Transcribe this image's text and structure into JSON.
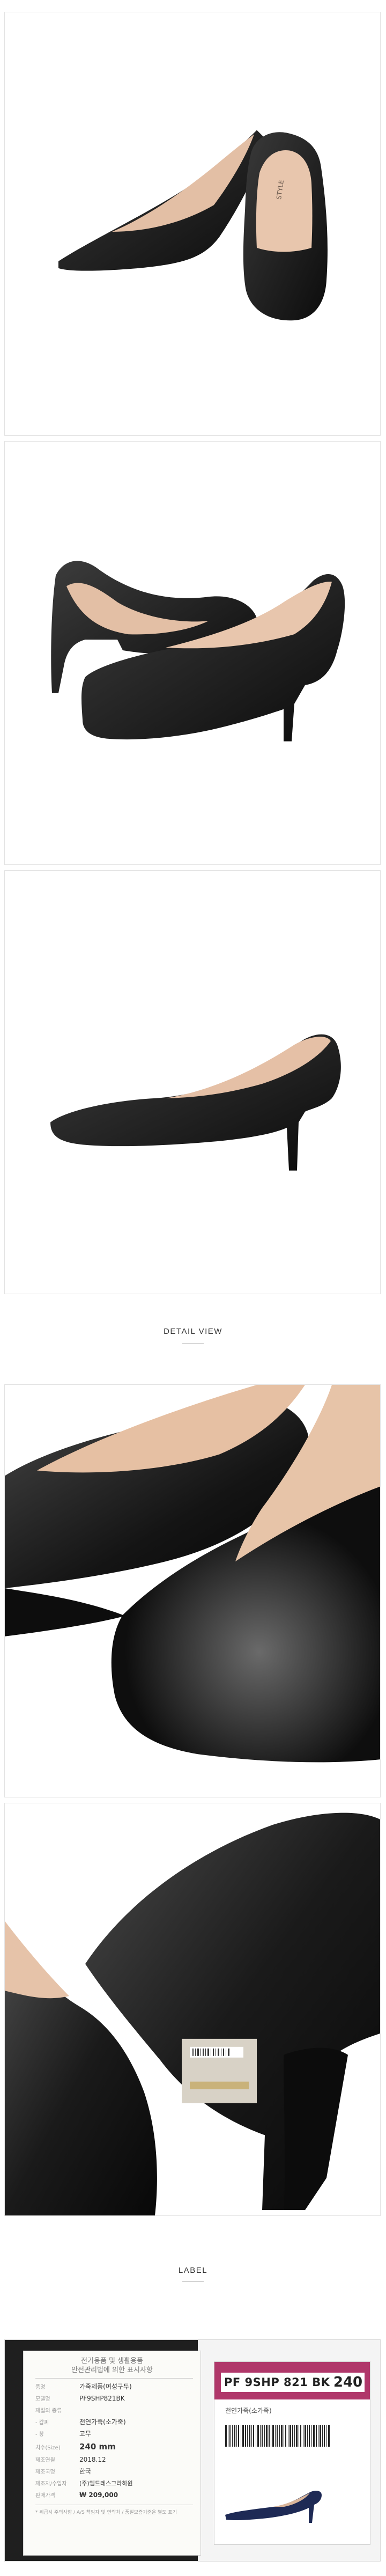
{
  "sections": {
    "detail_heading": "DETAIL VIEW",
    "label_heading": "LABEL"
  },
  "label_card": {
    "title_line1": "전기용품 및 생활용품",
    "title_line2": "안전관리법에 의한 표시사항",
    "rows": [
      {
        "key": "품명",
        "value": "가죽제품(여성구두)"
      },
      {
        "key": "모델명",
        "value": "PF9SHP821BK"
      },
      {
        "key": "재질의 종류",
        "value": ""
      },
      {
        "key": "- 갑피",
        "value": "천연가죽(소가죽)"
      },
      {
        "key": "- 창",
        "value": "고무"
      },
      {
        "key": "치수(Size)",
        "value": "240 mm"
      },
      {
        "key": "제조연월",
        "value": "2018.12"
      },
      {
        "key": "제조국명",
        "value": "한국"
      },
      {
        "key": "제조자/수입자",
        "value": "(주)엠드레스그라하원"
      },
      {
        "key": "판매가격",
        "value": "₩ 209,000"
      }
    ],
    "note": "* 취급시 주의사항 / A/S 책임자 및 연락처 / 품질보증기준은 별도 표기"
  },
  "price_tag": {
    "style_code": "PF 9SHP 821 BK",
    "size": "240",
    "material": "천연가죽(소가죽)"
  },
  "colors": {
    "tag_band": "#b0376a",
    "leather": "#161616",
    "lining": "#e3bfa5"
  }
}
